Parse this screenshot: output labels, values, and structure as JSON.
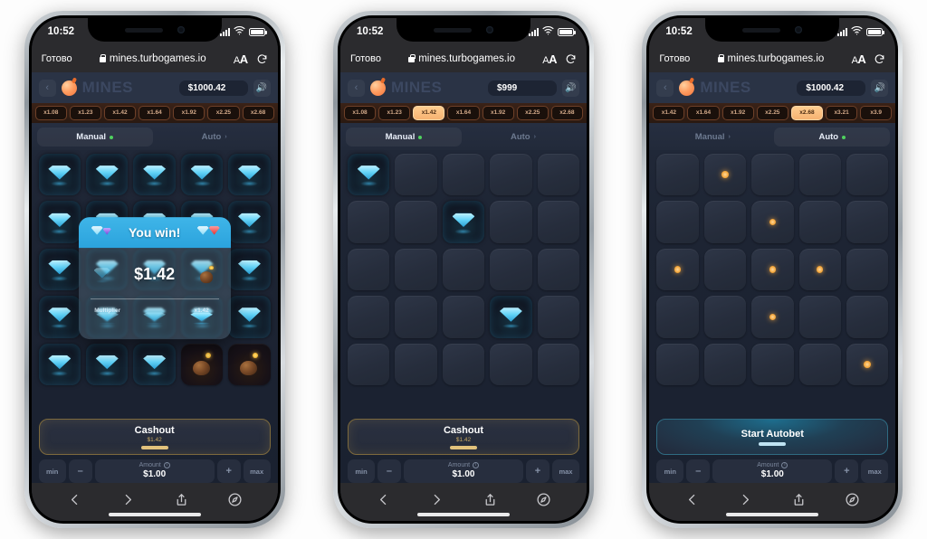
{
  "status_bar": {
    "time": "10:52",
    "signal_icon": "cellular-bars-icon",
    "wifi_icon": "wifi-icon",
    "battery_icon": "battery-icon"
  },
  "browser": {
    "done_label": "Готово",
    "url": "mines.turbogames.io",
    "lock_icon": "lock-icon",
    "text_size_label": "AA",
    "reload_icon": "reload-icon",
    "back_icon": "chevron-left-icon",
    "forward_icon": "chevron-right-icon",
    "share_icon": "share-icon",
    "tabs_icon": "compass-icon"
  },
  "game": {
    "title": "MINES",
    "back_icon": "chevron-left-icon",
    "logo_icon": "bomb-logo-icon",
    "sound_icon": "speaker-icon",
    "tabs": {
      "manual": "Manual",
      "auto": "Auto"
    },
    "amount": {
      "min": "min",
      "minus": "–",
      "label": "Amount",
      "value": "$1.00",
      "plus": "+",
      "max": "max",
      "info_icon": "info-icon"
    },
    "cashout": {
      "title": "Cashout",
      "sub": "$1.42"
    },
    "autobet": {
      "title": "Start Autobet"
    },
    "accent_gold": "#e2c27c",
    "accent_cyan": "#3fb5e8",
    "accent_green": "#4ed15f"
  },
  "phones": [
    {
      "id": "phone-1",
      "balance": "$1000.42",
      "multipliers": [
        "x1.08",
        "x1.23",
        "x1.42",
        "x1.64",
        "x1.92",
        "x2.25",
        "x2.68"
      ],
      "active_multiplier_index": -1,
      "active_tab": "manual",
      "action": "cashout",
      "grid": [
        [
          "gem",
          "gem",
          "gem",
          "gem",
          "gem"
        ],
        [
          "gem",
          "gem",
          "gem",
          "gem",
          "gem"
        ],
        [
          "gem",
          "gem",
          "gem",
          "gem",
          "gem"
        ],
        [
          "gem",
          "gem",
          "gem",
          "gem",
          "gem"
        ],
        [
          "gem",
          "gem",
          "gem",
          "bomb",
          "bomb"
        ]
      ],
      "modal": {
        "visible": true,
        "title": "You win!",
        "amount": "$1.42",
        "multiplier_label": "Multiplier",
        "multiplier_value": "x1.42",
        "gem_icon": "gem-icon",
        "bomb_icon": "bomb-icon"
      }
    },
    {
      "id": "phone-2",
      "balance": "$999",
      "multipliers": [
        "x1.08",
        "x1.23",
        "x1.42",
        "x1.64",
        "x1.92",
        "x2.25",
        "x2.68"
      ],
      "active_multiplier_index": 2,
      "active_tab": "manual",
      "action": "cashout",
      "grid": [
        [
          "gem",
          "hidden",
          "hidden",
          "hidden",
          "hidden"
        ],
        [
          "hidden",
          "hidden",
          "gem",
          "hidden",
          "hidden"
        ],
        [
          "hidden",
          "hidden",
          "hidden",
          "hidden",
          "hidden"
        ],
        [
          "hidden",
          "hidden",
          "hidden",
          "gem",
          "hidden"
        ],
        [
          "hidden",
          "hidden",
          "hidden",
          "hidden",
          "hidden"
        ]
      ],
      "modal": {
        "visible": false
      }
    },
    {
      "id": "phone-3",
      "balance": "$1000.42",
      "multipliers": [
        "x1.42",
        "x1.64",
        "x1.92",
        "x2.25",
        "x2.68",
        "x3.21",
        "x3.9"
      ],
      "active_multiplier_index": 4,
      "active_tab": "auto",
      "action": "autobet",
      "grid": [
        [
          "hidden",
          "dot",
          "hidden",
          "hidden",
          "hidden"
        ],
        [
          "hidden",
          "hidden",
          "dot",
          "hidden",
          "hidden"
        ],
        [
          "dot",
          "hidden",
          "dot",
          "dot",
          "hidden"
        ],
        [
          "hidden",
          "hidden",
          "dot",
          "hidden",
          "hidden"
        ],
        [
          "hidden",
          "hidden",
          "hidden",
          "hidden",
          "dot"
        ]
      ],
      "modal": {
        "visible": false
      }
    }
  ]
}
